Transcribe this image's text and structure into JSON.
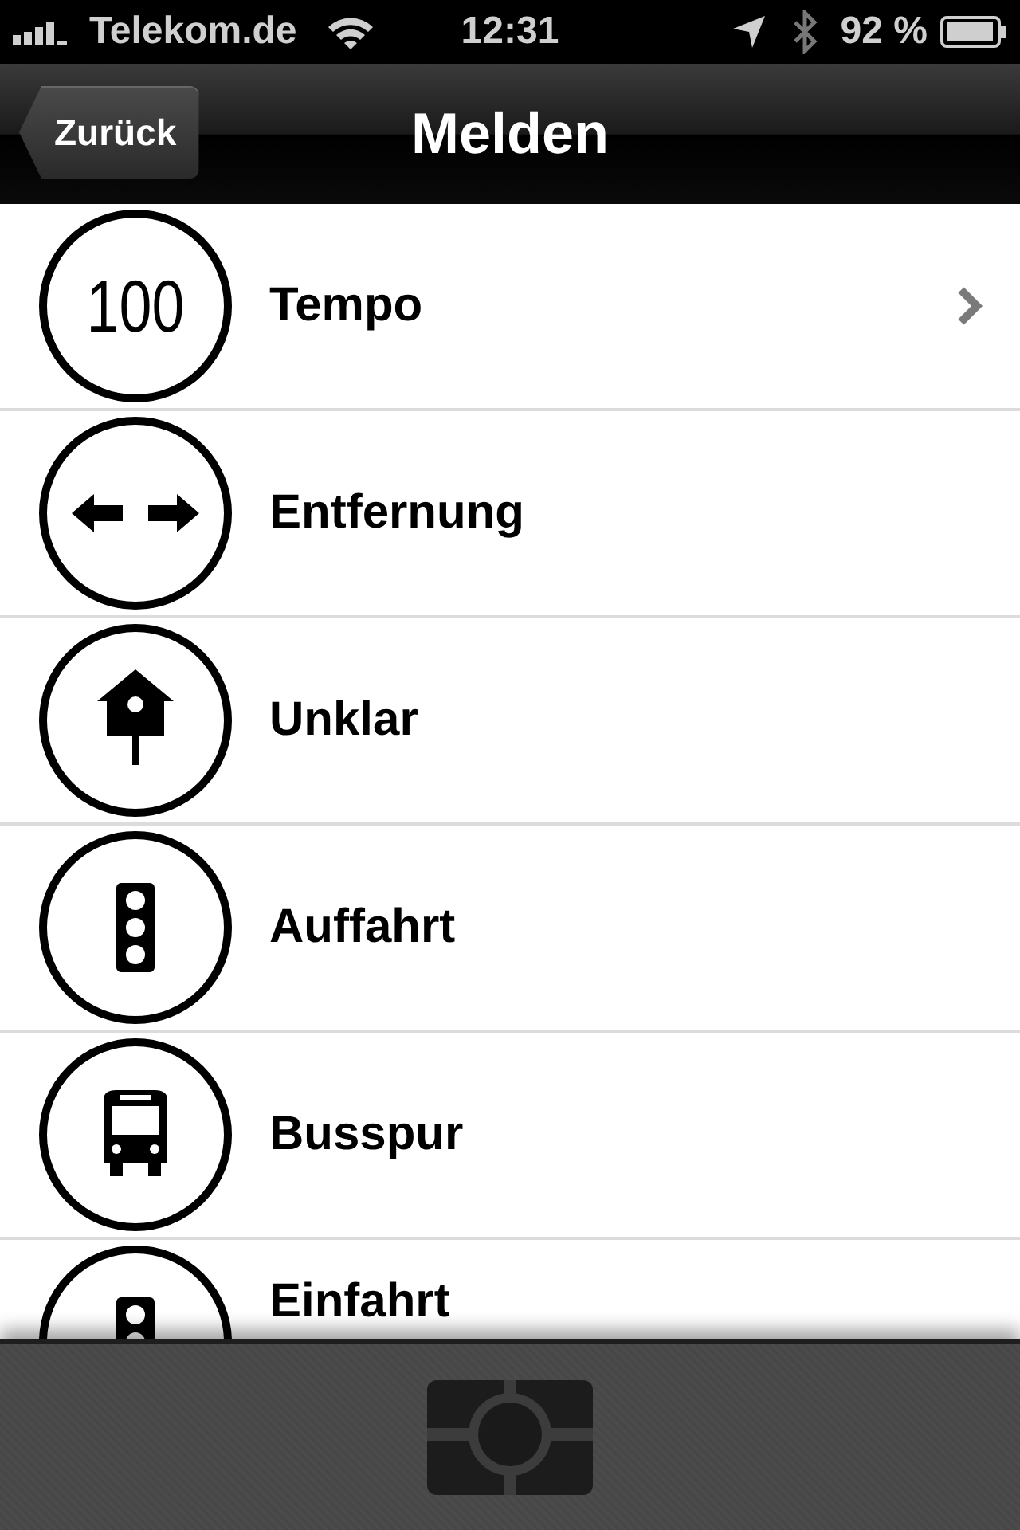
{
  "status_bar": {
    "carrier": "Telekom.de",
    "time": "12:31",
    "battery": "92 %"
  },
  "nav_bar": {
    "back": "Zurück",
    "title": "Melden"
  },
  "items": [
    {
      "label": "Tempo",
      "kind": "speed",
      "sign_text": "100",
      "chevron": true
    },
    {
      "label": "Entfernung",
      "kind": "distance",
      "chevron": false
    },
    {
      "label": "Unklar",
      "kind": "birdhouse",
      "chevron": false
    },
    {
      "label": "Auffahrt",
      "kind": "traffic_light",
      "chevron": false
    },
    {
      "label": "Busspur",
      "kind": "bus",
      "chevron": false
    },
    {
      "label": "Einfahrt",
      "kind": "traffic_light",
      "chevron": false
    }
  ]
}
